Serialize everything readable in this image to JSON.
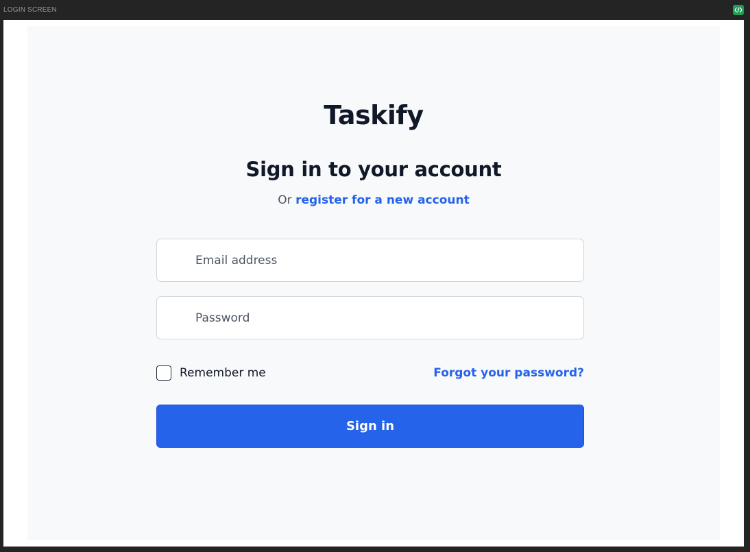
{
  "frame": {
    "title": "LOGIN SCREEN",
    "code_icon": "code-brackets-icon"
  },
  "app": {
    "brand": "Taskify"
  },
  "login": {
    "heading": "Sign in to your account",
    "subtext_prefix": "Or",
    "register_link": "register for a new account",
    "email_placeholder": "Email address",
    "password_placeholder": "Password",
    "remember_label": "Remember me",
    "remember_checked": false,
    "forgot_link": "Forgot your password?",
    "submit_label": "Sign in"
  },
  "colors": {
    "accent": "#2563eb",
    "text": "#111827",
    "muted": "#4b5563",
    "canvas": "#f8f9fb",
    "frame": "#242424"
  }
}
